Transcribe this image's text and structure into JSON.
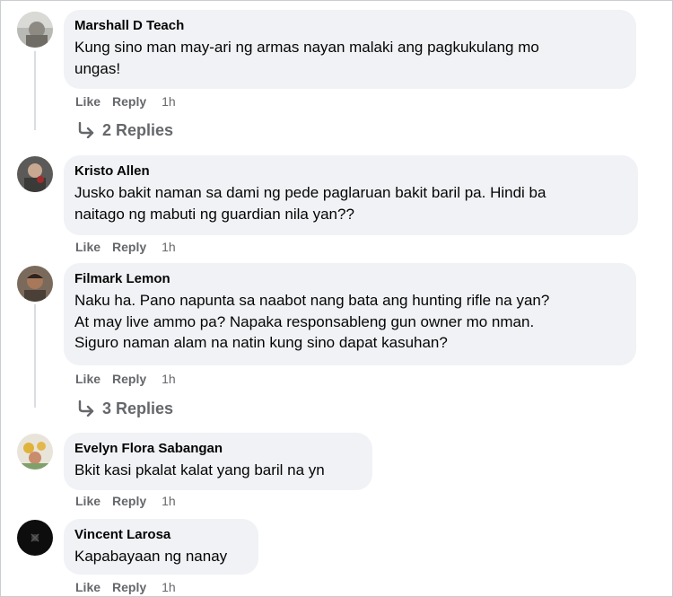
{
  "comments": [
    {
      "author": "Marshall D Teach",
      "lines": [
        "Kung sino man may-ari ng armas nayan malaki ang pagkukulang mo",
        "ungas!"
      ],
      "like": "Like",
      "reply": "Reply",
      "time": "1h",
      "replies": "2 Replies"
    },
    {
      "author": "Kristo Allen",
      "lines": [
        "Jusko bakit naman sa dami ng pede paglaruan bakit baril pa. Hindi ba",
        "naitago ng mabuti ng guardian nila yan??"
      ],
      "like": "Like",
      "reply": "Reply",
      "time": "1h"
    },
    {
      "author": "Filmark Lemon",
      "lines": [
        "Naku ha. Pano napunta sa naabot nang bata ang hunting rifle na yan?",
        "At may live ammo pa? Napaka responsableng gun owner mo nman.",
        "Siguro naman alam na natin kung sino dapat kasuhan?"
      ],
      "like": "Like",
      "reply": "Reply",
      "time": "1h",
      "replies": "3 Replies"
    },
    {
      "author": "Evelyn Flora Sabangan",
      "lines": [
        "Bkit kasi pkalat kalat yang baril na yn"
      ],
      "like": "Like",
      "reply": "Reply",
      "time": "1h"
    },
    {
      "author": "Vincent Larosa",
      "lines": [
        "Kapabayaan ng nanay"
      ],
      "like": "Like",
      "reply": "Reply",
      "time": "1h"
    }
  ],
  "colors": {
    "bubble": "#f0f2f5",
    "secondary_text": "#65676b",
    "primary_text": "#050505"
  },
  "icons": {
    "reply_arrow": "reply-arrow-icon"
  }
}
